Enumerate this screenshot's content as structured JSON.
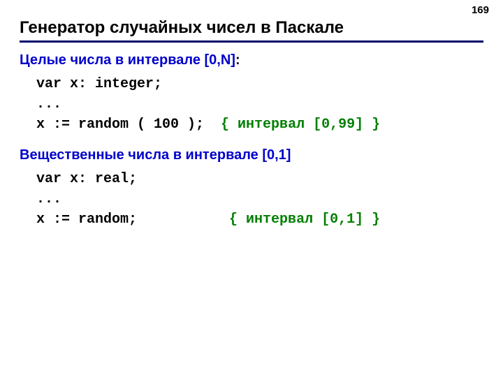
{
  "page_number": "169",
  "title": "Генератор случайных чисел в Паскале",
  "section1": {
    "heading_blue": "Целые числа в интервале [0,N]",
    "heading_black": ":",
    "code_line1": "var x: integer;",
    "code_line2": "...",
    "code_line3a": "x := random ( 100 );  ",
    "code_line3b": "{ интервал [0,99] }"
  },
  "section2": {
    "heading_blue": "Вещественные числа в интервале [0,1]",
    "code_line1": "var x: real;",
    "code_line2": "...",
    "code_line3a": "x := random;           ",
    "code_line3b": "{ интервал [0,1] }"
  }
}
